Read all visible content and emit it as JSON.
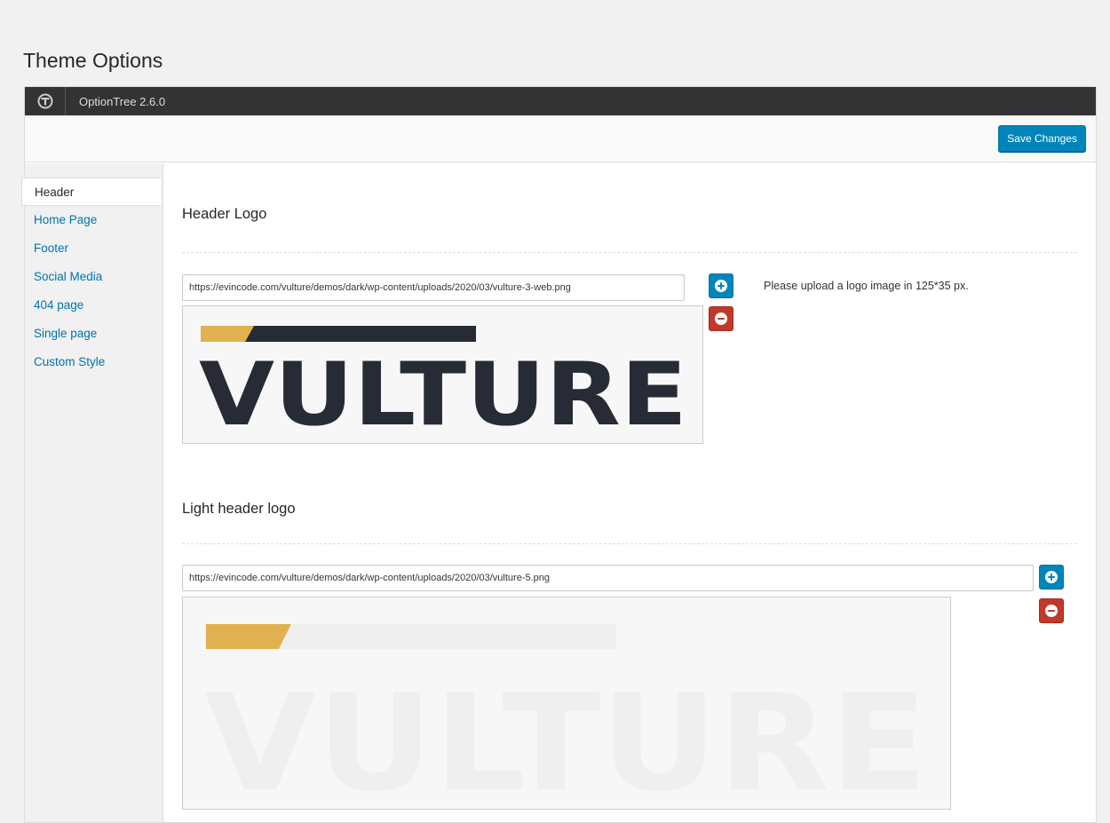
{
  "page": {
    "title": "Theme Options"
  },
  "topbar": {
    "version": "OptionTree 2.6.0",
    "logo_icon": "optiontree-logo-icon"
  },
  "toolbar": {
    "save_label": "Save Changes"
  },
  "sidebar": {
    "items": [
      {
        "label": "Header",
        "active": true
      },
      {
        "label": "Home Page",
        "active": false
      },
      {
        "label": "Footer",
        "active": false
      },
      {
        "label": "Social Media",
        "active": false
      },
      {
        "label": "404 page",
        "active": false
      },
      {
        "label": "Single page",
        "active": false
      },
      {
        "label": "Custom Style",
        "active": false
      }
    ]
  },
  "fields": [
    {
      "title": "Header Logo",
      "value": "https://evincode.com/vulture/demos/dark/wp-content/uploads/2020/03/vulture-3-web.png",
      "description": "Please upload a logo image in 125*35 px.",
      "preview_text": "VULTURE",
      "preview_variant": "dark"
    },
    {
      "title": "Light header logo",
      "value": "https://evincode.com/vulture/demos/dark/wp-content/uploads/2020/03/vulture-5.png",
      "description": "",
      "preview_text": "VULTURE",
      "preview_variant": "light"
    }
  ],
  "colors": {
    "accent": "#0085ba",
    "danger": "#c0392b",
    "logo_gold": "#e0b14e",
    "logo_dark": "#262b36",
    "logo_light": "#efefef"
  },
  "icons": {
    "add": "plus-circle-icon",
    "remove": "minus-circle-icon"
  }
}
